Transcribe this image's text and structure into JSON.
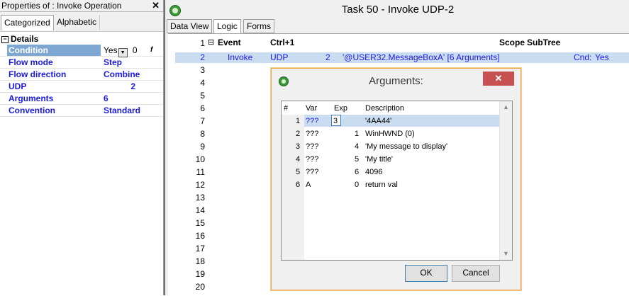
{
  "properties_panel": {
    "title": "Properties of : Invoke Operation",
    "close_glyph": "✕",
    "tabs": [
      "Categorized",
      "Alphabetic"
    ],
    "section_glyph": "−",
    "section": "Details",
    "rows": [
      {
        "name": "Condition",
        "value": "Yes",
        "extra": "0"
      },
      {
        "name": "Flow mode",
        "value": "Step"
      },
      {
        "name": "Flow direction",
        "value": "Combine"
      },
      {
        "name": "UDP",
        "value": "2"
      },
      {
        "name": "Arguments",
        "value": "6"
      },
      {
        "name": "Convention",
        "value": "Standard"
      }
    ]
  },
  "main_window": {
    "title": "Task 50 -   Invoke UDP-2",
    "tabs": [
      "Data View",
      "Logic",
      "Forms"
    ],
    "active_tab": "Logic",
    "header": {
      "collapse_glyph": "⊟",
      "event": "Event",
      "ctrl": "Ctrl+1",
      "scope": "Scope",
      "subtree": "SubTree"
    },
    "row2": {
      "op": "Invoke",
      "type": "UDP",
      "num": "2",
      "detail": "'@USER32.MessageBoxA' [6 Arguments]",
      "cnd_label": "Cnd:",
      "cnd_value": "Yes"
    },
    "line_numbers": [
      "1",
      "2",
      "3",
      "4",
      "5",
      "6",
      "7",
      "8",
      "9",
      "10",
      "11",
      "12",
      "13",
      "14",
      "15",
      "16",
      "17",
      "18",
      "19",
      "20"
    ]
  },
  "dialog": {
    "title": "Arguments:",
    "close_glyph": "✕",
    "columns": [
      "#",
      "Var",
      "Exp",
      "Description"
    ],
    "rows": [
      {
        "num": "1",
        "var": "???",
        "exp": "3",
        "desc": "'4AA44'"
      },
      {
        "num": "2",
        "var": "???",
        "exp": "1",
        "desc": "WinHWND (0)"
      },
      {
        "num": "3",
        "var": "???",
        "exp": "4",
        "desc": "'My message to display'"
      },
      {
        "num": "4",
        "var": "???",
        "exp": "5",
        "desc": "'My title'"
      },
      {
        "num": "5",
        "var": "???",
        "exp": "6",
        "desc": "4096"
      },
      {
        "num": "6",
        "var": "A",
        "exp": "0",
        "desc": "return val"
      }
    ],
    "scroll_up_glyph": "▲",
    "scroll_down_glyph": "▼",
    "ok_label": "OK",
    "cancel_label": "Cancel"
  },
  "colors": {
    "selection": "#c9dcf0",
    "link_blue": "#1a1ae6",
    "dialog_close": "#c75050"
  }
}
